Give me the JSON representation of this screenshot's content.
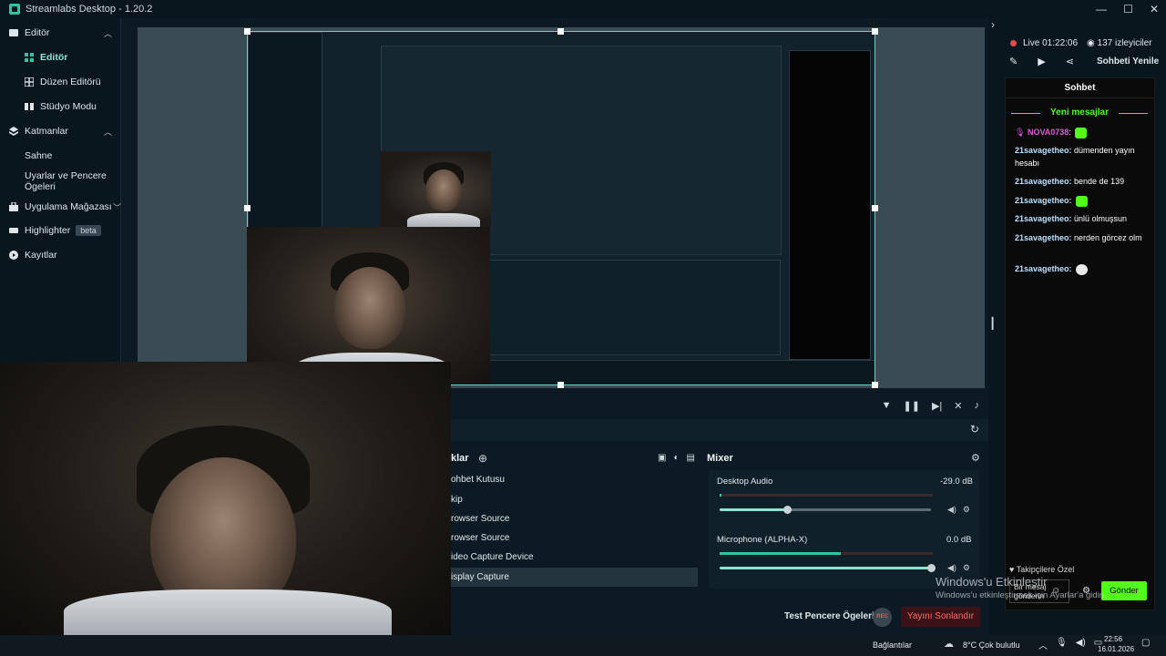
{
  "window": {
    "title": "Streamlabs Desktop - 1.20.2"
  },
  "sidebar": {
    "items": [
      {
        "label": "Editör",
        "icon": "editor-icon"
      },
      {
        "label": "Editör",
        "icon": "editor-grid-icon"
      },
      {
        "label": "Düzen Editörü",
        "icon": "layout-icon"
      },
      {
        "label": "Stüdyo Modu",
        "icon": "studio-icon"
      },
      {
        "label": "Katmanlar",
        "icon": "layers-icon"
      },
      {
        "label": "Sahne",
        "icon": ""
      },
      {
        "label": "Uyarlar ve Pencere Ögeleri",
        "icon": ""
      },
      {
        "label": "Uygulama Mağazası",
        "icon": "store-icon"
      },
      {
        "label": "Highlighter",
        "icon": "highlighter-icon",
        "badge": "beta"
      },
      {
        "label": "Kayıtlar",
        "icon": "recordings-icon"
      }
    ]
  },
  "sources": {
    "title": "klar",
    "items": [
      "ohbet Kutusu",
      "kip",
      "rowser Source",
      "rowser Source",
      "ideo Capture Device",
      "isplay Capture"
    ]
  },
  "mixer": {
    "title": "Mixer",
    "channels": [
      {
        "name": "Desktop Audio",
        "db": "-29.0 dB",
        "level": 0.01,
        "volume": 0.32
      },
      {
        "name": "Microphone (ALPHA-X)",
        "db": "0.0 dB",
        "level": 0.57,
        "volume": 1.0
      }
    ]
  },
  "footer": {
    "test_label": "Test Pencere Ögeleri",
    "rec_label": "REC",
    "end_label": "Yayını Sonlandır"
  },
  "live": {
    "status": "Live 01:22:06",
    "viewers": "137 izleyiciler",
    "refresh": "Sohbeti Yenile"
  },
  "chat": {
    "title": "Sohbet",
    "new_messages": "Yeni mesajlar",
    "messages": [
      {
        "user": "NOVA0738",
        "text": ":"
      },
      {
        "user": "21savagetheo:",
        "text": " dümenden yayın hesabı"
      },
      {
        "user": "21savagetheo:",
        "text": " bende de 139"
      },
      {
        "user": "21savagetheo:",
        "text": ""
      },
      {
        "user": "21savagetheo:",
        "text": " ünlü olmuşsun"
      },
      {
        "user": "21savagetheo:",
        "text": " nerden görcez olm"
      },
      {
        "user": "21savagetheo:",
        "text": ""
      }
    ],
    "follower_only": "Takipçilere Özel",
    "input_placeholder": "Bir mesaj gönderin",
    "send": "Gönder"
  },
  "watermark": {
    "line1": "Windows'u Etkinleştir",
    "line2": "Windows'u etkinleştirmek için Ayarlar'a gidin."
  },
  "taskbar": {
    "connections": "Bağlantılar",
    "weather": "8°C  Çok bulutlu",
    "time": "22:56",
    "date": "16.01.2026"
  },
  "colors": {
    "accent": "#31c3a2",
    "chat_green": "#53fc18",
    "live_red": "#e34b4b"
  }
}
